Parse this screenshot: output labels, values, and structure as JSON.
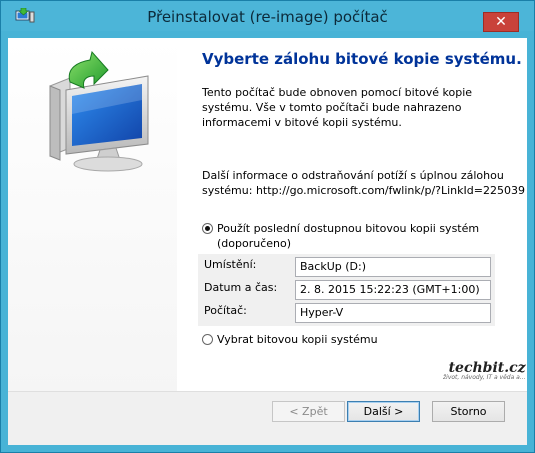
{
  "window": {
    "title": "Přeinstalovat (re-image) počítač",
    "close_glyph": "✕"
  },
  "content": {
    "heading": "Vyberte zálohu bitové kopie systému.",
    "description": "Tento počítač bude obnoven pomocí bitové kopie systému. Vše v tomto počítači bude nahrazeno informacemi v bitové kopii systému.",
    "more_info": "Další informace o odstraňování potíží s úplnou zálohou systému: http://go.microsoft.com/fwlink/p/?LinkId=225039",
    "more_info_line1": "Další informace o odstraňování potíží s úplnou zálohou",
    "more_info_line2": "systému: http://go.microsoft.com/fwlink/p/?LinkId=225039",
    "option_latest": {
      "label_line1": "Použít poslední dostupnou bitovou kopii systém",
      "label_line2": "(doporučeno)",
      "selected": true
    },
    "details": {
      "location_label": "Umístění:",
      "location_value": "BackUp (D:)",
      "datetime_label": "Datum a čas:",
      "datetime_value": "2. 8. 2015 15:22:23 (GMT+1:00)",
      "computer_label": "Počítač:",
      "computer_value": "Hyper-V"
    },
    "option_select": {
      "label": "Vybrat bitovou kopii systému",
      "selected": false
    }
  },
  "watermark": {
    "main": "techbit.cz",
    "sub": "život, návody, IT a věda a..."
  },
  "buttons": {
    "back": "< Zpět",
    "next": "Další >",
    "cancel": "Storno"
  },
  "icons": {
    "app": "system-image-icon",
    "hero": "monitor-restore-arrow-icon",
    "close": "close-icon"
  },
  "colors": {
    "heading": "#003399",
    "titlebar": "#4cb5d8",
    "close": "#c9423a"
  }
}
